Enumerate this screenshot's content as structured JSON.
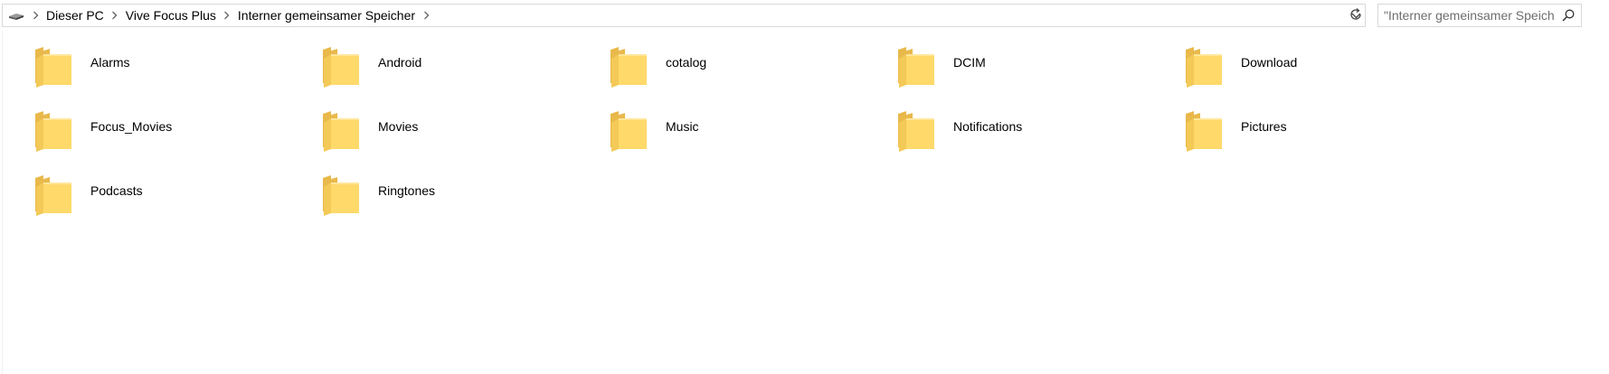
{
  "breadcrumb": {
    "items": [
      {
        "label": "Dieser PC"
      },
      {
        "label": "Vive Focus Plus"
      },
      {
        "label": "Interner gemeinsamer Speicher"
      }
    ]
  },
  "search": {
    "placeholder": "\"Interner gemeinsamer Speich..."
  },
  "icons": {
    "drive": "drive-icon",
    "chevron": "chevron-right-icon",
    "dropdown": "chevron-down-icon",
    "refresh": "refresh-icon",
    "search": "search-icon",
    "folder": "folder-icon"
  },
  "colors": {
    "folder_back": "#e8b84a",
    "folder_front": "#ffd96a",
    "border": "#d9d9d9"
  },
  "folders": [
    {
      "name": "Alarms"
    },
    {
      "name": "Android"
    },
    {
      "name": "cotalog"
    },
    {
      "name": "DCIM"
    },
    {
      "name": "Download"
    },
    {
      "name": "Focus_Movies"
    },
    {
      "name": "Movies"
    },
    {
      "name": "Music"
    },
    {
      "name": "Notifications"
    },
    {
      "name": "Pictures"
    },
    {
      "name": "Podcasts"
    },
    {
      "name": "Ringtones"
    }
  ]
}
